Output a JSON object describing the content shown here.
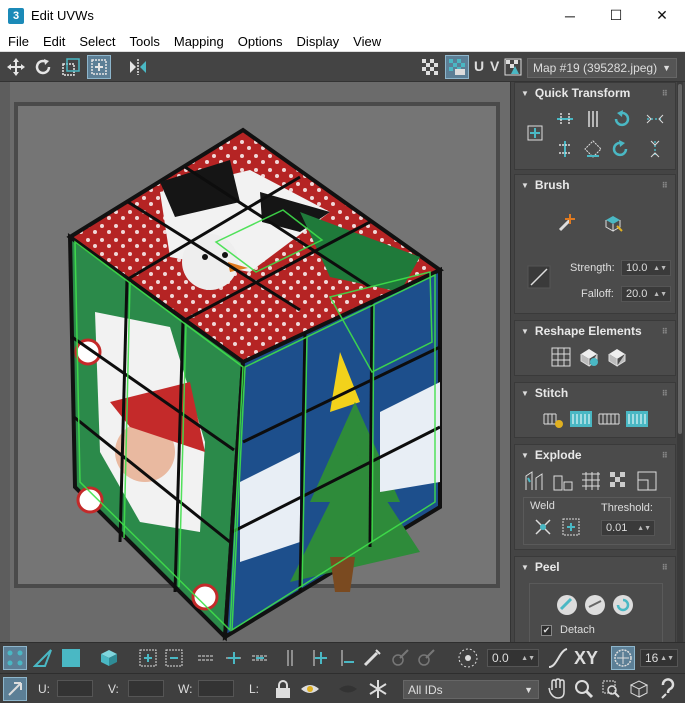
{
  "window": {
    "title": "Edit UVWs",
    "app_icon_label": "3",
    "minimize": "─",
    "maximize": "☐",
    "close": "✕"
  },
  "menu": [
    "File",
    "Edit",
    "Select",
    "Tools",
    "Mapping",
    "Options",
    "Display",
    "View"
  ],
  "toolbar": {
    "uv_label": "U V",
    "map_select": "Map #19 (395282.jpeg)"
  },
  "panel": {
    "quick_transform": {
      "title": "Quick Transform"
    },
    "brush": {
      "title": "Brush",
      "strength_label": "Strength:",
      "strength_value": "10.0",
      "falloff_label": "Falloff:",
      "falloff_value": "20.0"
    },
    "reshape": {
      "title": "Reshape Elements"
    },
    "stitch": {
      "title": "Stitch"
    },
    "explode": {
      "title": "Explode",
      "weld_label": "Weld",
      "threshold_label": "Threshold:",
      "threshold_value": "0.01"
    },
    "peel": {
      "title": "Peel",
      "detach_label": "Detach"
    }
  },
  "bottom": {
    "offset_value": "0.0",
    "xy_label": "XY",
    "grid_value": "16",
    "u_label": "U:",
    "v_label": "V:",
    "w_label": "W:",
    "l_label": "L:",
    "ids_select": "All IDs"
  },
  "colors": {
    "accent": "#4ab8c4",
    "active_bg": "#5c7f96",
    "edge_green": "#3fe04a"
  }
}
